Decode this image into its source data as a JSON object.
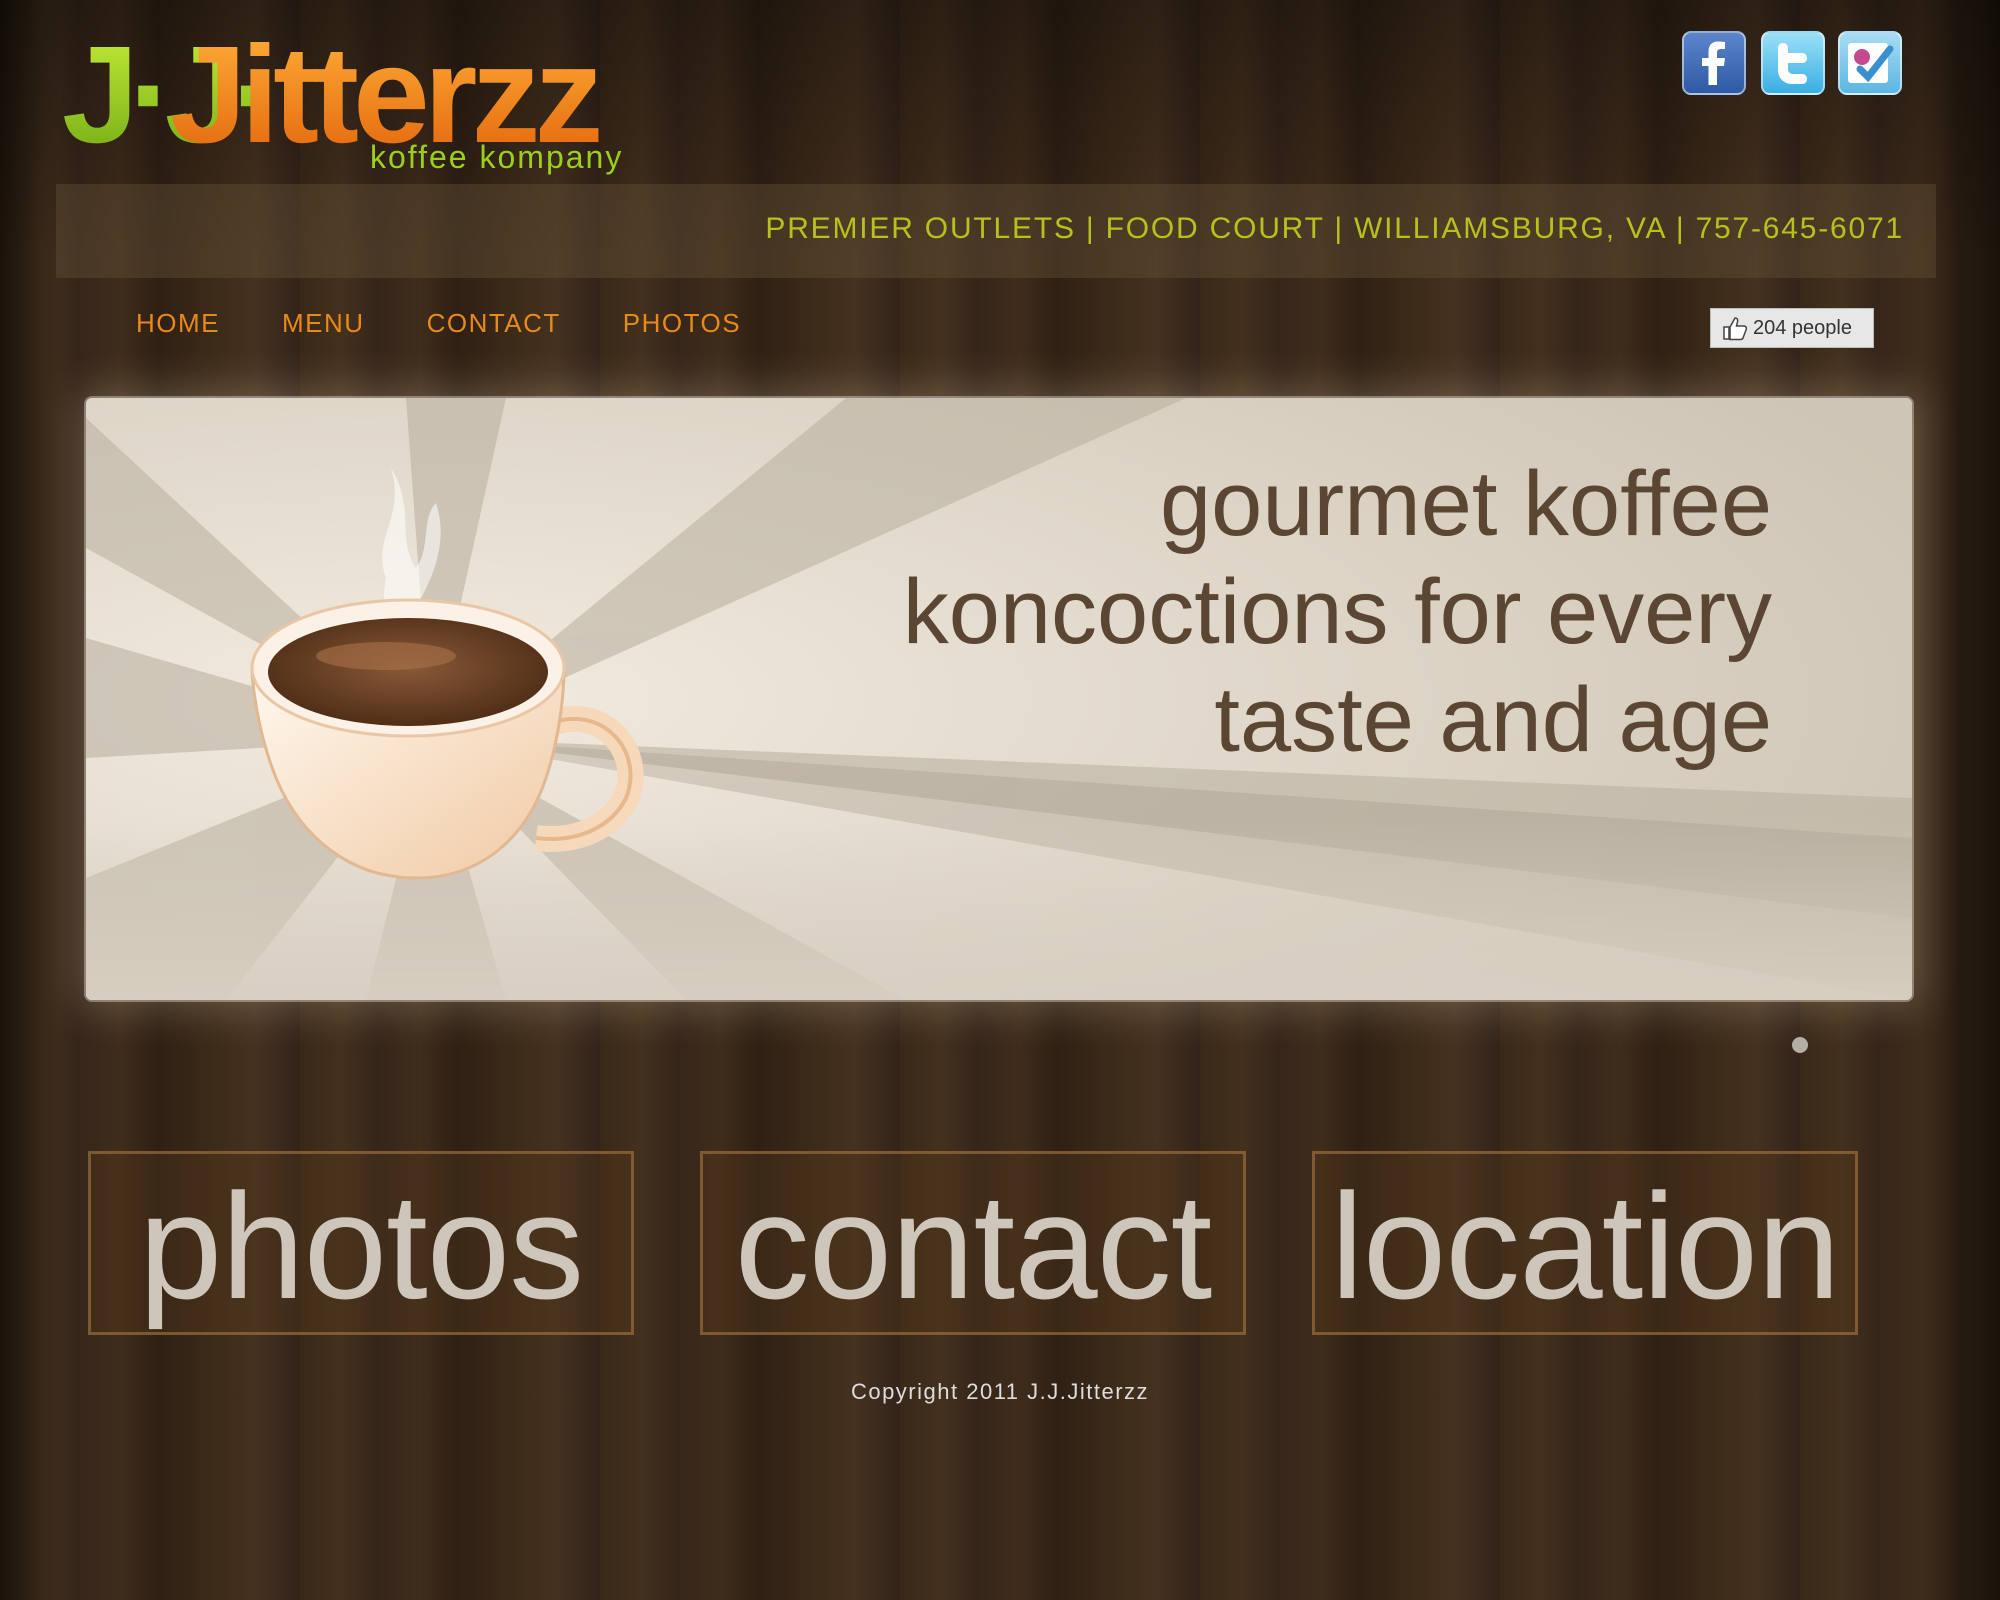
{
  "brand": {
    "name_part_jj": "J·J·",
    "name_part_jitterzz": "Jitterzz",
    "tagline": "koffee kompany",
    "colors": {
      "green": "#9bcf1b",
      "orange": "#f08a0c"
    }
  },
  "social": [
    {
      "icon": "facebook-icon"
    },
    {
      "icon": "twitter-icon"
    },
    {
      "icon": "foursquare-icon"
    }
  ],
  "address": {
    "text": "PREMIER OUTLETS | FOOD COURT | WILLIAMSBURG, VA | 757-645-6071"
  },
  "nav": {
    "items": [
      {
        "label": "HOME"
      },
      {
        "label": "MENU"
      },
      {
        "label": "CONTACT"
      },
      {
        "label": "PHOTOS"
      }
    ]
  },
  "like": {
    "count_text": "204 people"
  },
  "banner": {
    "lines": [
      "gourmet koffee",
      "koncoctions for every",
      "taste and age"
    ]
  },
  "features": {
    "photos": "photos",
    "contact": "contact",
    "location": "location"
  },
  "footer": {
    "copyright": "Copyright 2011 J.J.Jitterzz"
  },
  "colors": {
    "address_text": "#b6c11c",
    "nav_text": "#e78a1a",
    "banner_text": "#5a4632",
    "feature_text": "#cfc6bb"
  }
}
